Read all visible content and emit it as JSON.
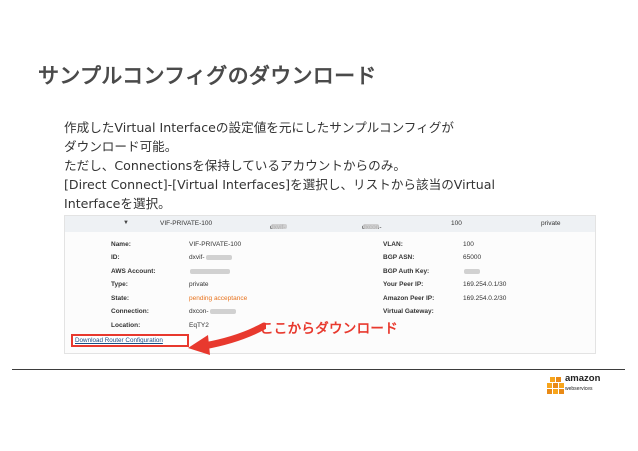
{
  "slide": {
    "title": "サンプルコンフィグのダウンロード",
    "body_lines": [
      "作成したVirtual Interfaceの設定値を元にしたサンプルコンフィグが",
      "ダウンロード可能。",
      "ただし、Connectionsを保持しているアカウントからのみ。",
      "[Direct Connect]-[Virtual Interfaces]を選択し、リストから該当のVirtual",
      "Interfaceを選択。"
    ]
  },
  "console": {
    "row": {
      "name": "VIF-PRIVATE-100",
      "id_prefix": "dxvif-",
      "connection_prefix": "dxcon-",
      "vlan": "100",
      "type": "private"
    },
    "details": {
      "labels": {
        "name": "Name:",
        "id": "ID:",
        "aws_account": "AWS Account:",
        "type": "Type:",
        "state": "State:",
        "connection": "Connection:",
        "location": "Location:",
        "vlan": "VLAN:",
        "bgp_asn": "BGP ASN:",
        "bgp_auth_key": "BGP Auth Key:",
        "your_peer_ip": "Your Peer IP:",
        "amazon_peer_ip": "Amazon Peer IP:",
        "virtual_gateway": "Virtual Gateway:"
      },
      "values": {
        "name": "VIF-PRIVATE-100",
        "id": "dxvif-",
        "aws_account": "",
        "type": "private",
        "state": "pending acceptance",
        "connection": "dxcon-",
        "location": "EqTY2",
        "vlan": "100",
        "bgp_asn": "65000",
        "bgp_auth_key": "",
        "your_peer_ip": "169.254.0.1/30",
        "amazon_peer_ip": "169.254.0.2/30",
        "virtual_gateway": ""
      }
    },
    "download_button": "Download Router Configuration"
  },
  "callout": "ここからダウンロード",
  "logo": {
    "name": "amazon",
    "sub": "webservices",
    "icon": "aws-cubes-logo"
  },
  "colors": {
    "accent_red": "#e8392e",
    "pending_orange": "#e8731d",
    "link_blue": "#1a4f86"
  }
}
